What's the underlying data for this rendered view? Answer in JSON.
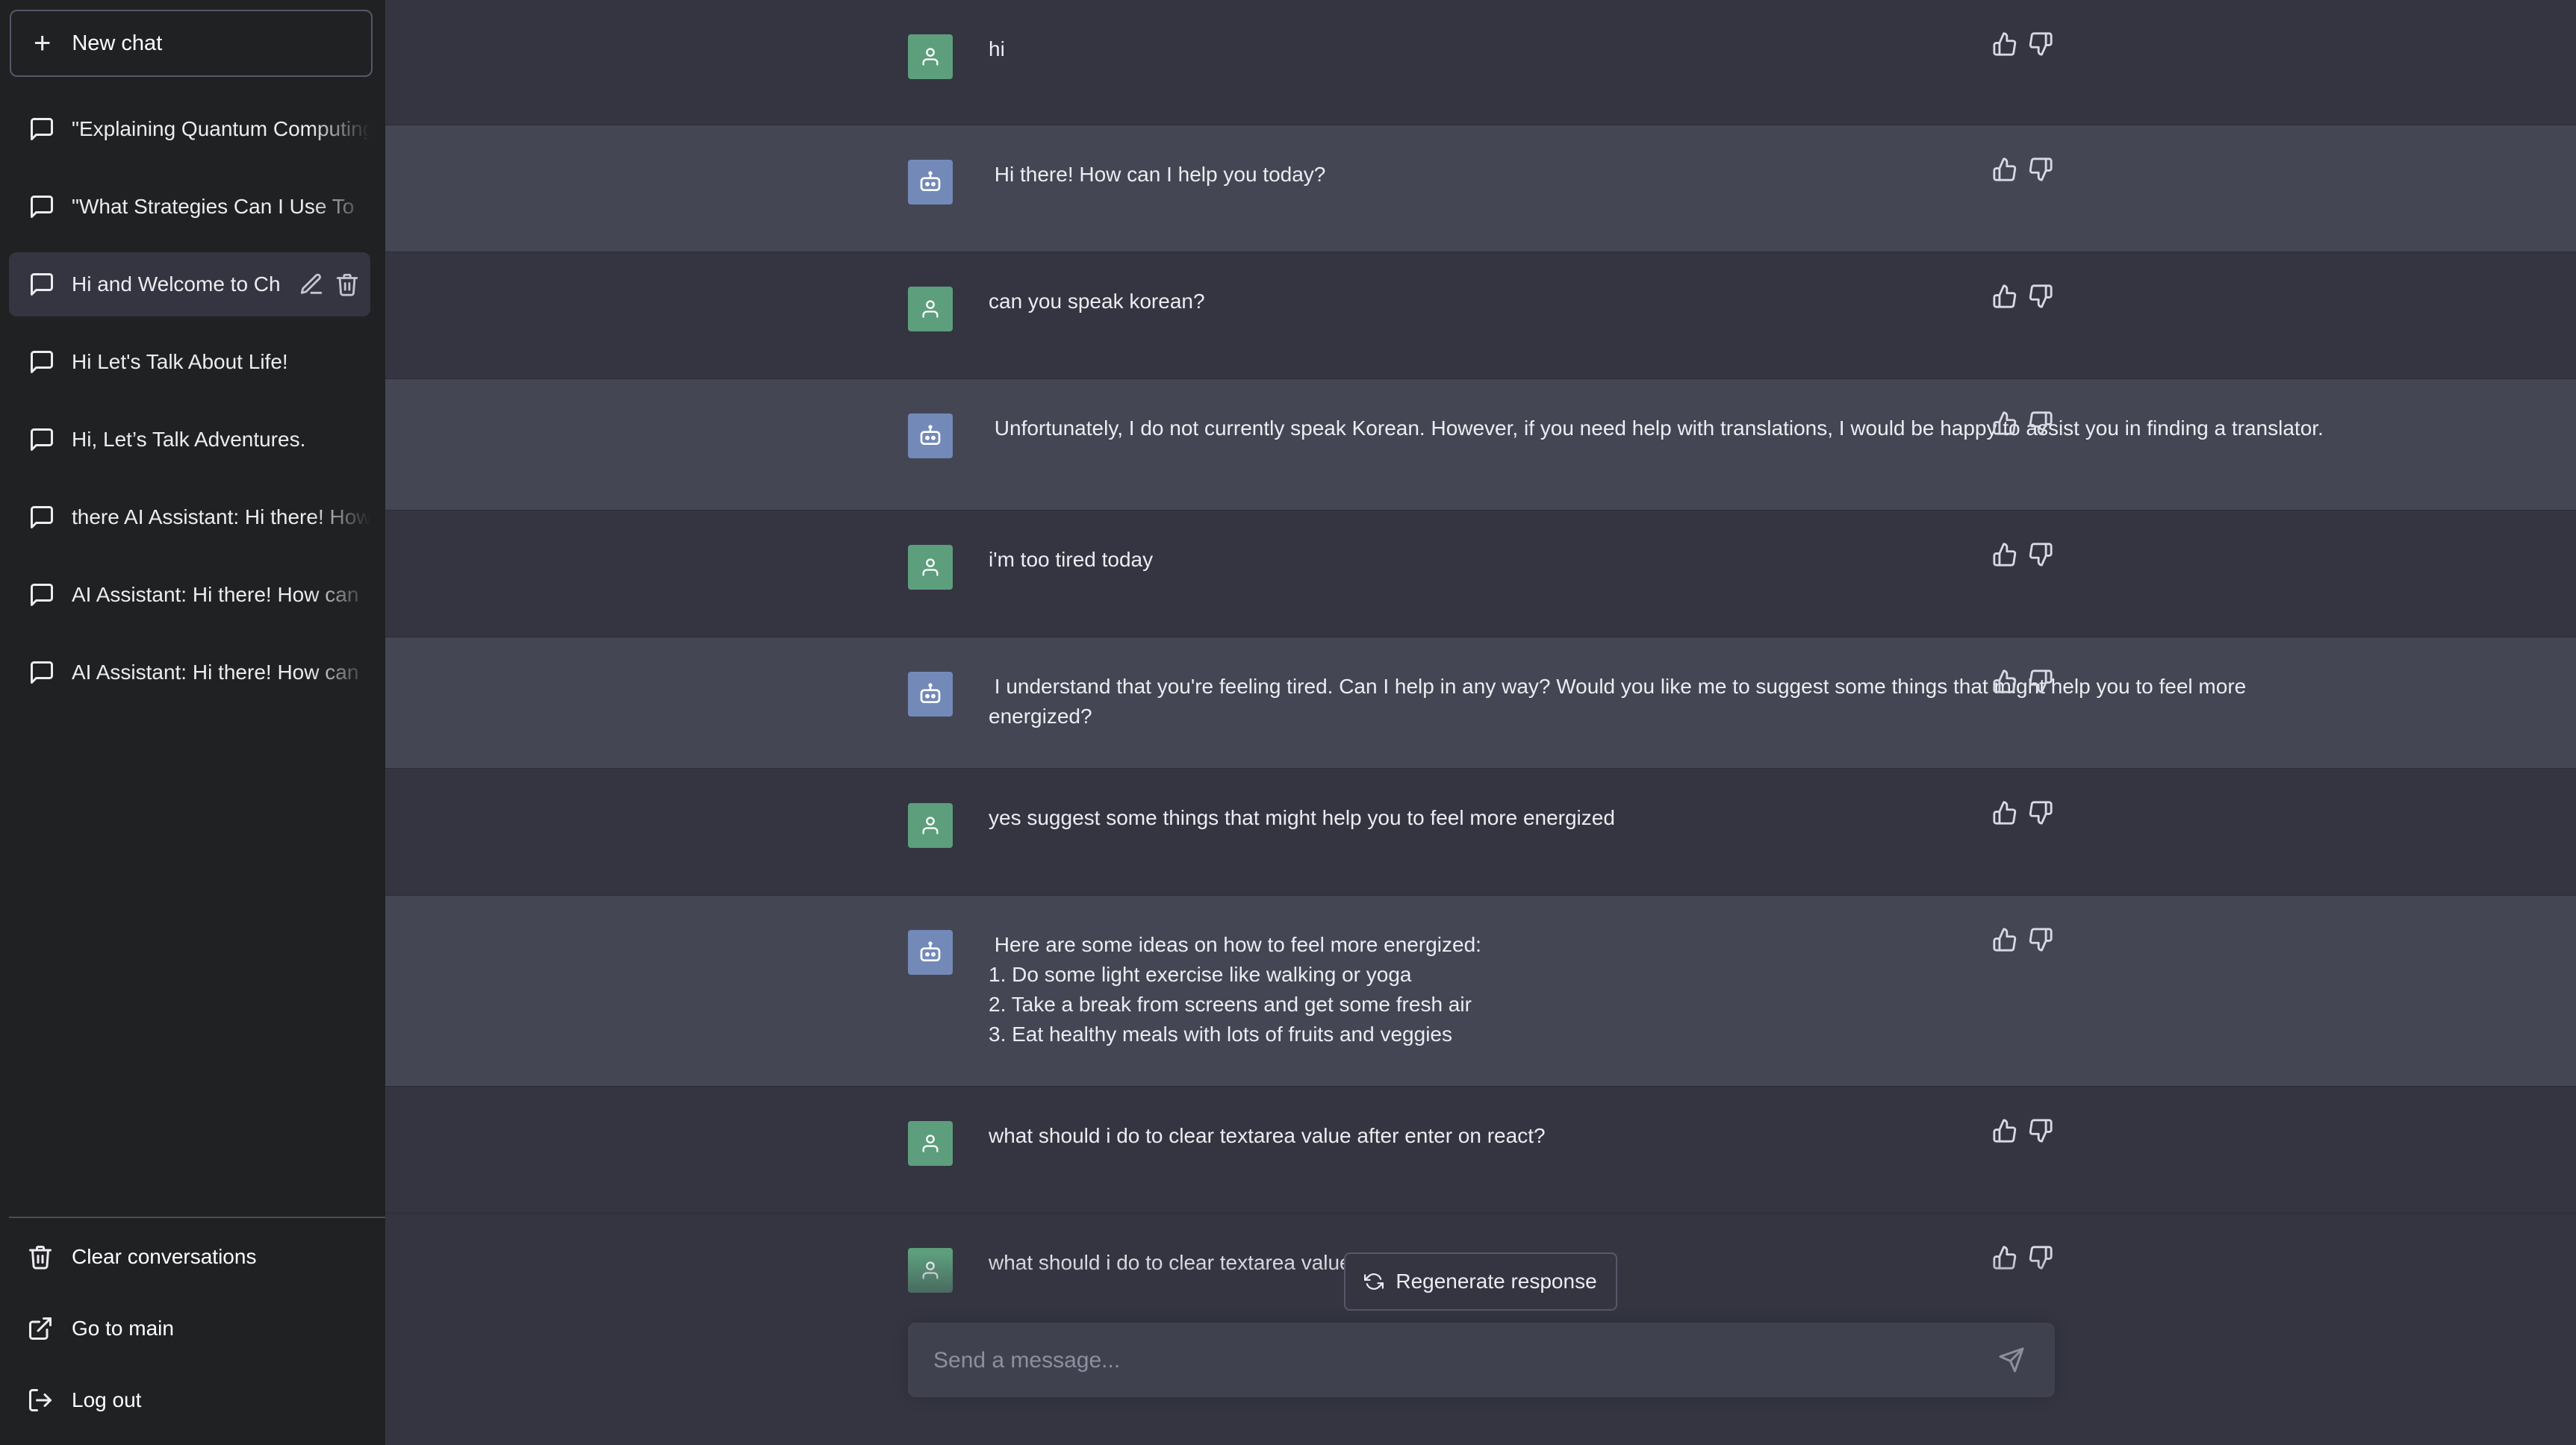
{
  "sidebar": {
    "new_chat_label": "New chat",
    "conversations": [
      {
        "label": "\"Explaining Quantum Computing\""
      },
      {
        "label": "\"What Strategies Can I Use To"
      },
      {
        "label": "Hi and Welcome to Ch",
        "active": true
      },
      {
        "label": "Hi Let's Talk About Life!"
      },
      {
        "label": "Hi, Let’s Talk Adventures."
      },
      {
        "label": "there AI Assistant: Hi there! How"
      },
      {
        "label": "AI Assistant: Hi there! How can"
      },
      {
        "label": "AI Assistant: Hi there! How can"
      }
    ],
    "bottom": {
      "clear_label": "Clear conversations",
      "main_label": "Go to main",
      "logout_label": "Log out"
    }
  },
  "messages": [
    {
      "role": "user",
      "text": "hi"
    },
    {
      "role": "assistant",
      "text": " Hi there! How can I help you today?"
    },
    {
      "role": "user",
      "text": "can you speak korean?"
    },
    {
      "role": "assistant",
      "text": " Unfortunately, I do not currently speak Korean. However, if you need help with translations, I would be happy to assist you in finding a translator."
    },
    {
      "role": "user",
      "text": "i'm too tired today"
    },
    {
      "role": "assistant",
      "text": " I understand that you're feeling tired. Can I help in any way? Would you like me to suggest some things that might help you to feel more energized?"
    },
    {
      "role": "user",
      "text": "yes suggest some things that might help you to feel more energized"
    },
    {
      "role": "assistant",
      "text": " Here are some ideas on how to feel more energized:\n1. Do some light exercise like walking or yoga\n2. Take a break from screens and get some fresh air\n3. Eat healthy meals with lots of fruits and veggies"
    },
    {
      "role": "user",
      "text": "what should i do to clear textarea value after enter on react?"
    },
    {
      "role": "user",
      "text": "what should i do to clear textarea value after enter on react?"
    }
  ],
  "composer": {
    "regenerate_label": "Regenerate response",
    "placeholder": "Send a message..."
  },
  "colors": {
    "sidebar_bg": "#202123",
    "user_row_bg": "#343541",
    "assistant_row_bg": "#444654",
    "user_avatar": "#5d9e7d",
    "bot_avatar": "#7389b8"
  }
}
